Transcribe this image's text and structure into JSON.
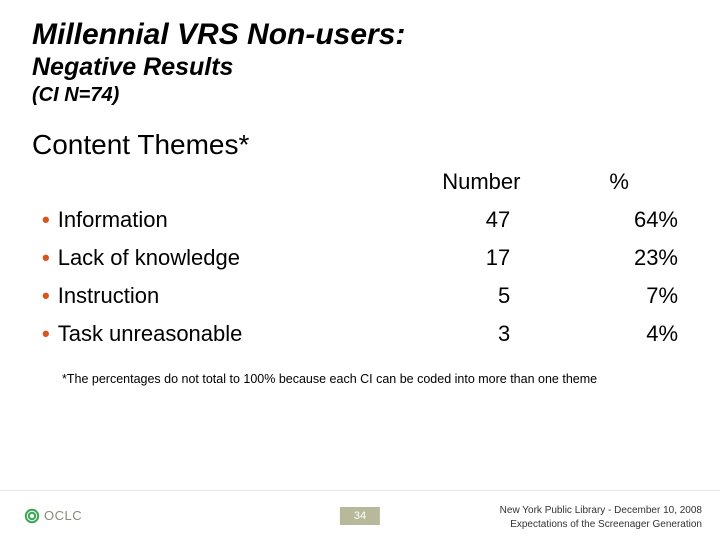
{
  "title": "Millennial VRS Non-users:",
  "subtitle": "Negative Results",
  "ci": "(CI N=74)",
  "section": "Content Themes*",
  "columns": {
    "label": "",
    "number": "Number",
    "percent": "%"
  },
  "rows": [
    {
      "label": "Information",
      "number": "47",
      "percent": "64%"
    },
    {
      "label": "Lack of knowledge",
      "number": "17",
      "percent": "23%"
    },
    {
      "label": "Instruction",
      "number": "5",
      "percent": "7%"
    },
    {
      "label": "Task unreasonable",
      "number": "3",
      "percent": "4%"
    }
  ],
  "footnote": "*The percentages do not total to 100% because each CI can be coded into more than one theme",
  "logo_text": "OCLC",
  "page_number": "34",
  "credit_line1": "New York Public Library - December 10, 2008",
  "credit_line2": "Expectations of the Screenager Generation",
  "chart_data": {
    "type": "table",
    "title": "Content Themes",
    "categories": [
      "Information",
      "Lack of knowledge",
      "Instruction",
      "Task unreasonable"
    ],
    "series": [
      {
        "name": "Number",
        "values": [
          47,
          17,
          5,
          3
        ]
      },
      {
        "name": "%",
        "values": [
          64,
          23,
          7,
          4
        ]
      }
    ]
  }
}
